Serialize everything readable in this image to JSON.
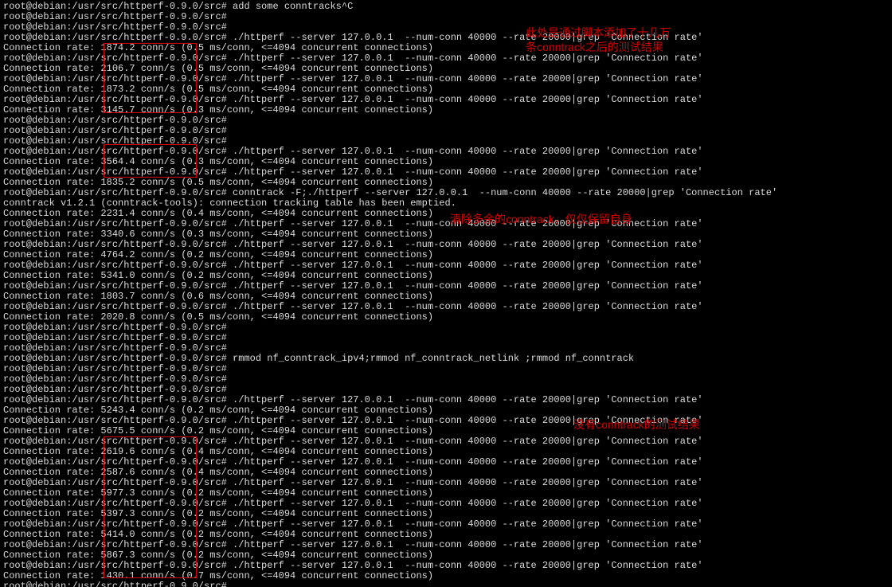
{
  "prompt": "root@debian:/usr/src/httperf-0.9.0/src#",
  "first_cmd": " add some conntracks^C",
  "httperf_cmd": " ./httperf --server 127.0.0.1  --num-conn 40000 --rate 20000|grep 'Connection rate'",
  "flush_cmd": " conntrack -F;./httperf --server 127.0.0.1  --num-conn 40000 --rate 20000|grep 'Connection rate'",
  "flush_msg": "conntrack v1.2.1 (conntrack-tools): connection tracking table has been emptied.",
  "rmmod_cmd": " rmmod nf_conntrack_ipv4;rmmod nf_conntrack_netlink ;rmmod nf_conntrack",
  "block1_rates": [
    {
      "rate": "1874.2",
      "ms": "0.5"
    },
    {
      "rate": "2106.7",
      "ms": "0.5"
    },
    {
      "rate": "1873.2",
      "ms": "0.5"
    },
    {
      "rate": "3145.7",
      "ms": "0.3"
    }
  ],
  "block2_rates": [
    {
      "rate": "3564.4",
      "ms": "0.3"
    },
    {
      "rate": "1835.2",
      "ms": "0.5"
    }
  ],
  "block3_rates": [
    {
      "rate": "2231.4",
      "ms": "0.4"
    },
    {
      "rate": "3340.6",
      "ms": "0.3"
    },
    {
      "rate": "4764.2",
      "ms": "0.2"
    },
    {
      "rate": "5341.0",
      "ms": "0.2"
    },
    {
      "rate": "1803.7",
      "ms": "0.6"
    },
    {
      "rate": "2020.8",
      "ms": "0.5"
    }
  ],
  "block4_rates": [
    {
      "rate": "5243.4",
      "ms": "0.2"
    },
    {
      "rate": "5675.5",
      "ms": "0.2"
    },
    {
      "rate": "2619.6",
      "ms": "0.4"
    },
    {
      "rate": "2587.6",
      "ms": "0.4"
    },
    {
      "rate": "5977.3",
      "ms": "0.2"
    },
    {
      "rate": "5397.3",
      "ms": "0.2"
    },
    {
      "rate": "5414.0",
      "ms": "0.2"
    },
    {
      "rate": "5867.3",
      "ms": "0.2"
    },
    {
      "rate": "1430.1",
      "ms": "0.7"
    }
  ],
  "connrate_prefix": "Connection rate: ",
  "connrate_mid": " conn/s (",
  "connrate_suffix": " ms/conn, <=4094 concurrent connections)",
  "anno1_line1": "此处是通过脚本添加了十几万",
  "anno1_line2": "条conntrack之后的测试结果",
  "anno2": "清除多余的conntrack，仅仅保留自身",
  "anno3": "没有conntrack的测试结果"
}
